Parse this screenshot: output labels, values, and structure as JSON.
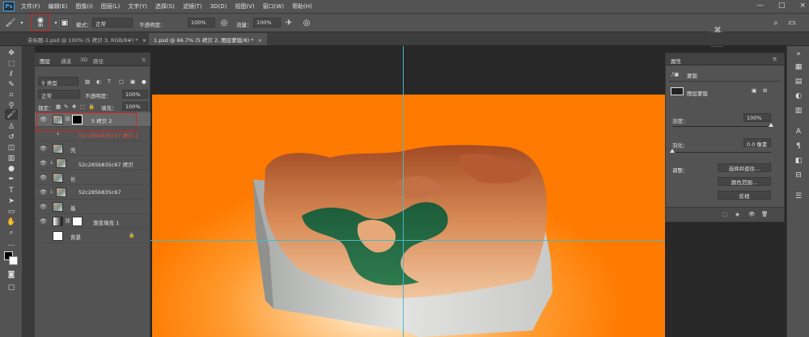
{
  "app": {
    "logo": "Ps"
  },
  "menu": {
    "items": [
      "文件(F)",
      "编辑(E)",
      "图像(I)",
      "图层(L)",
      "文字(Y)",
      "选择(S)",
      "滤镜(T)",
      "3D(D)",
      "视图(V)",
      "窗口(W)",
      "帮助(H)"
    ]
  },
  "window_controls": {
    "minimize": "—",
    "maximize": "□",
    "close": "×"
  },
  "options": {
    "brush_size": "90",
    "mode_label": "模式：",
    "mode_value": "正常",
    "opacity_label": "不透明度：",
    "opacity_value": "100%",
    "flow_label": "流量：",
    "flow_value": "100%"
  },
  "tabs": [
    {
      "label": "未标题-1.psd @ 100% (5 拷贝 3, RGB/8#) *",
      "close": "×"
    },
    {
      "label": "1.psd @ 66.7% (5 拷贝 2, 图层蒙版/8) *",
      "close": "×"
    }
  ],
  "layers_panel": {
    "tabs": [
      "图层",
      "通道",
      "3D",
      "路径"
    ],
    "kind_label": "类型",
    "blend_mode": "正常",
    "opacity_label": "不透明度：",
    "opacity_value": "100%",
    "lock_label": "锁定：",
    "fill_label": "填充：",
    "fill_value": "100%",
    "layers": [
      {
        "name": "5 拷贝 2"
      },
      {
        "name": "52c285b835c67 拷贝 2"
      },
      {
        "name": "壳"
      },
      {
        "name": "52c285b835c67 拷贝"
      },
      {
        "name": "长"
      },
      {
        "name": "52c285b835c67"
      },
      {
        "name": "基"
      },
      {
        "name": "渐变填充 1"
      },
      {
        "name": "背景"
      }
    ]
  },
  "properties": {
    "title": "属性",
    "section": "蒙版",
    "mask_type": "图层蒙版",
    "density_label": "浓度：",
    "density_value": "100%",
    "density": 1.0,
    "feather_label": "羽化：",
    "feather_value": "0.0 像素",
    "feather": 0.0,
    "adjust_label": "调整：",
    "btn_select_mask": "选择并遮住...",
    "btn_color_range": "颜色范围...",
    "btn_invert": "反相"
  },
  "colors": {
    "accent_red": "#c62828",
    "guide": "#48b9c7",
    "bg_orange": "#ff7a00"
  }
}
